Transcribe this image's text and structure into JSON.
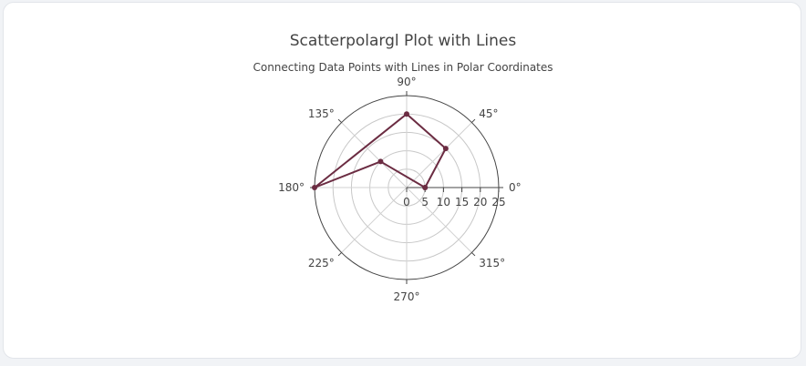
{
  "chart_data": {
    "type": "scatter",
    "subtype": "polar",
    "mode": "lines+markers",
    "title": "Scatterpolargl Plot with Lines",
    "subtitle": "Connecting Data Points with Lines in Polar Coordinates",
    "r": [
      5,
      15,
      20,
      25,
      10,
      5
    ],
    "theta": [
      0,
      45,
      90,
      180,
      135,
      0
    ],
    "radial_range": [
      0,
      25
    ],
    "radial_ticks": [
      "0",
      "5",
      "10",
      "15",
      "20",
      "25"
    ],
    "angular_ticks": [
      "0°",
      "45°",
      "90°",
      "135°",
      "180°",
      "225°",
      "270°",
      "315°"
    ],
    "line_color": "#6b2c42",
    "marker_color": "#6b2c42",
    "grid": true
  }
}
